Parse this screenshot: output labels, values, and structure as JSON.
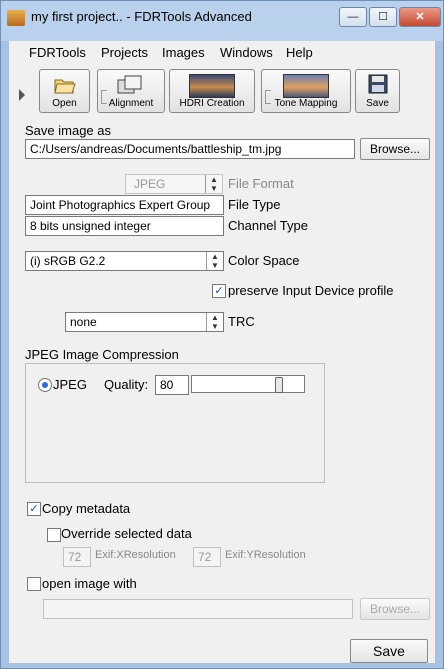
{
  "window": {
    "title": "my first project.. - FDRTools Advanced",
    "min": "—",
    "max": "☐",
    "close": "✕"
  },
  "menu": {
    "items": [
      "FDRTools",
      "Projects",
      "Images",
      "Windows",
      "Help"
    ]
  },
  "toolbar": {
    "open": "Open",
    "alignment": "Alignment",
    "hdri_creation": "HDRI Creation",
    "tone_mapping": "Tone Mapping",
    "save": "Save"
  },
  "save": {
    "heading": "Save image as",
    "path": "C:/Users/andreas/Documents/battleship_tm.jpg",
    "browse": "Browse..."
  },
  "format": {
    "file_format_value": "JPEG",
    "file_format_label": "File Format",
    "file_type_value": "Joint Photographics Expert Group",
    "file_type_label": "File Type",
    "channel_type_value": "8 bits unsigned integer",
    "channel_type_label": "Channel Type"
  },
  "color": {
    "space_value": "(i) sRGB G2.2",
    "space_label": "Color Space",
    "preserve_label": "preserve Input Device profile",
    "preserve_checked": true,
    "trc_value": "none",
    "trc_label": "TRC"
  },
  "jpeg": {
    "heading": "JPEG Image Compression",
    "radio_label": "JPEG",
    "quality_label": "Quality:",
    "quality_value": "80",
    "quality_fraction": 0.8
  },
  "metadata": {
    "copy_label": "Copy metadata",
    "copy_checked": true,
    "override_label": "Override selected data",
    "override_checked": false,
    "xres_value": "72",
    "xres_label": "Exif:XResolution",
    "yres_value": "72",
    "yres_label": "Exif:YResolution"
  },
  "open_with": {
    "label": "open image with",
    "checked": false,
    "path": "",
    "browse": "Browse..."
  },
  "footer": {
    "save": "Save"
  }
}
